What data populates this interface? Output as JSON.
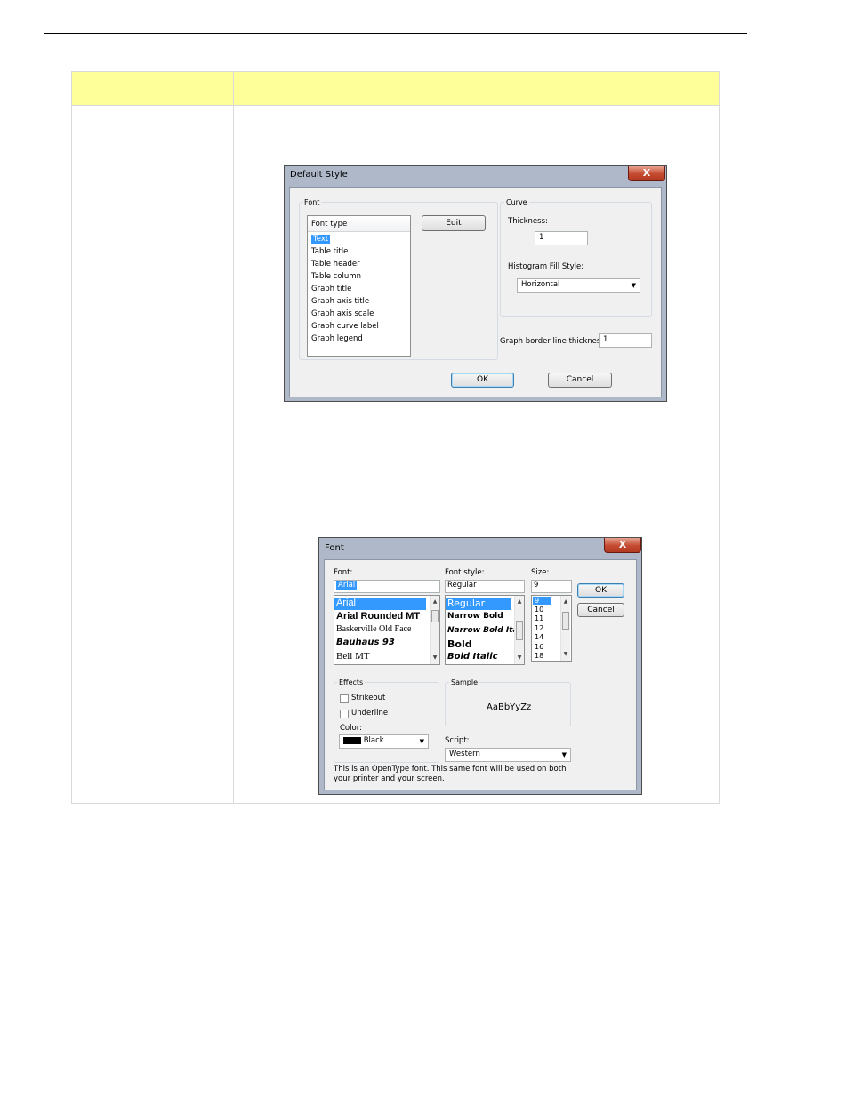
{
  "default_style": {
    "title": "Default Style",
    "close": "X",
    "font_group": "Font",
    "font_list_header": "Font type",
    "font_items": [
      "Text",
      "Table title",
      "Table header",
      "Table column",
      "Graph title",
      "Graph axis title",
      "Graph axis scale",
      "Graph curve label",
      "Graph legend"
    ],
    "edit_button": "Edit",
    "curve_group": "Curve",
    "thickness_label": "Thickness:",
    "thickness_value": "1",
    "histogram_label": "Histogram Fill Style:",
    "histogram_value": "Horizontal",
    "border_label": "Graph border line thickness:",
    "border_value": "1",
    "ok": "OK",
    "cancel": "Cancel"
  },
  "font_dialog": {
    "title": "Font",
    "close": "X",
    "font_label": "Font:",
    "font_value": "Arial",
    "fonts": [
      "Arial",
      "Arial Rounded MT",
      "Baskerville Old Face",
      "Bauhaus 93",
      "Bell MT"
    ],
    "style_label": "Font style:",
    "style_value": "Regular",
    "styles": [
      "Regular",
      "Narrow Bold",
      "Narrow Bold Italic",
      "Bold",
      "Bold Italic"
    ],
    "size_label": "Size:",
    "size_value": "9",
    "sizes": [
      "9",
      "10",
      "11",
      "12",
      "14",
      "16",
      "18"
    ],
    "ok": "OK",
    "cancel": "Cancel",
    "effects_group": "Effects",
    "strikeout": "Strikeout",
    "underline": "Underline",
    "color_label": "Color:",
    "color_value": "Black",
    "sample_group": "Sample",
    "sample_text": "AaBbYyZz",
    "script_label": "Script:",
    "script_value": "Western",
    "note": "This is an OpenType font. This same font will be used on both your printer and your screen."
  }
}
